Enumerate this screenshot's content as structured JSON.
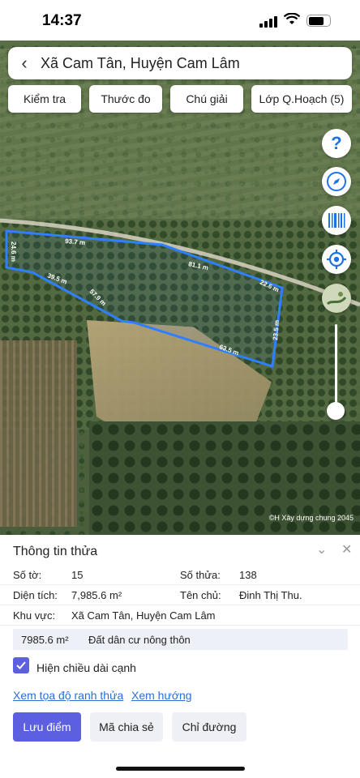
{
  "status": {
    "time": "14:37"
  },
  "header": {
    "back_icon": "chevron-left-icon",
    "title": "Xã Cam Tân, Huyện Cam Lâm"
  },
  "toolbar": {
    "check_label": "Kiểm tra",
    "measure_label": "Thước đo",
    "legend_label": "Chú giải",
    "layers_label": "Lớp Q.Hoạch (5)"
  },
  "map": {
    "parcel_color": "#2f80ff",
    "edge_labels": [
      "93.7 m",
      "81.1 m",
      "22.6 m",
      "23.5 m",
      "63.5 m",
      "57.9 m",
      "39.5 m",
      "24.6 m"
    ],
    "attribution": "©H Xây dựng chung 2045",
    "controls": [
      "help-icon",
      "compass-icon",
      "barcode-icon",
      "locate-icon",
      "basemap-icon"
    ],
    "zoom_level": 0.08
  },
  "panel": {
    "title": "Thông tin thửa",
    "sheet_label": "Số tờ:",
    "sheet_value": "15",
    "parcel_label": "Số thửa:",
    "parcel_value": "138",
    "area_label": "Diện tích:",
    "area_value": "7,985.6 m²",
    "owner_label": "Tên chủ:",
    "owner_value": "Đinh Thị Thu.",
    "region_label": "Khu vực:",
    "region_value": "Xã Cam Tân, Huyện Cam Lâm",
    "landuse_area": "7985.6 m²",
    "landuse_type": "Đất dân cư nông thôn",
    "show_edges_label": "Hiện chiều dài cạnh",
    "coords_link": "Xem tọa độ ranh thửa",
    "direction_link": "Xem hướng",
    "save_button": "Lưu điểm",
    "share_button": "Mã chia sẻ",
    "route_button": "Chỉ đường"
  }
}
